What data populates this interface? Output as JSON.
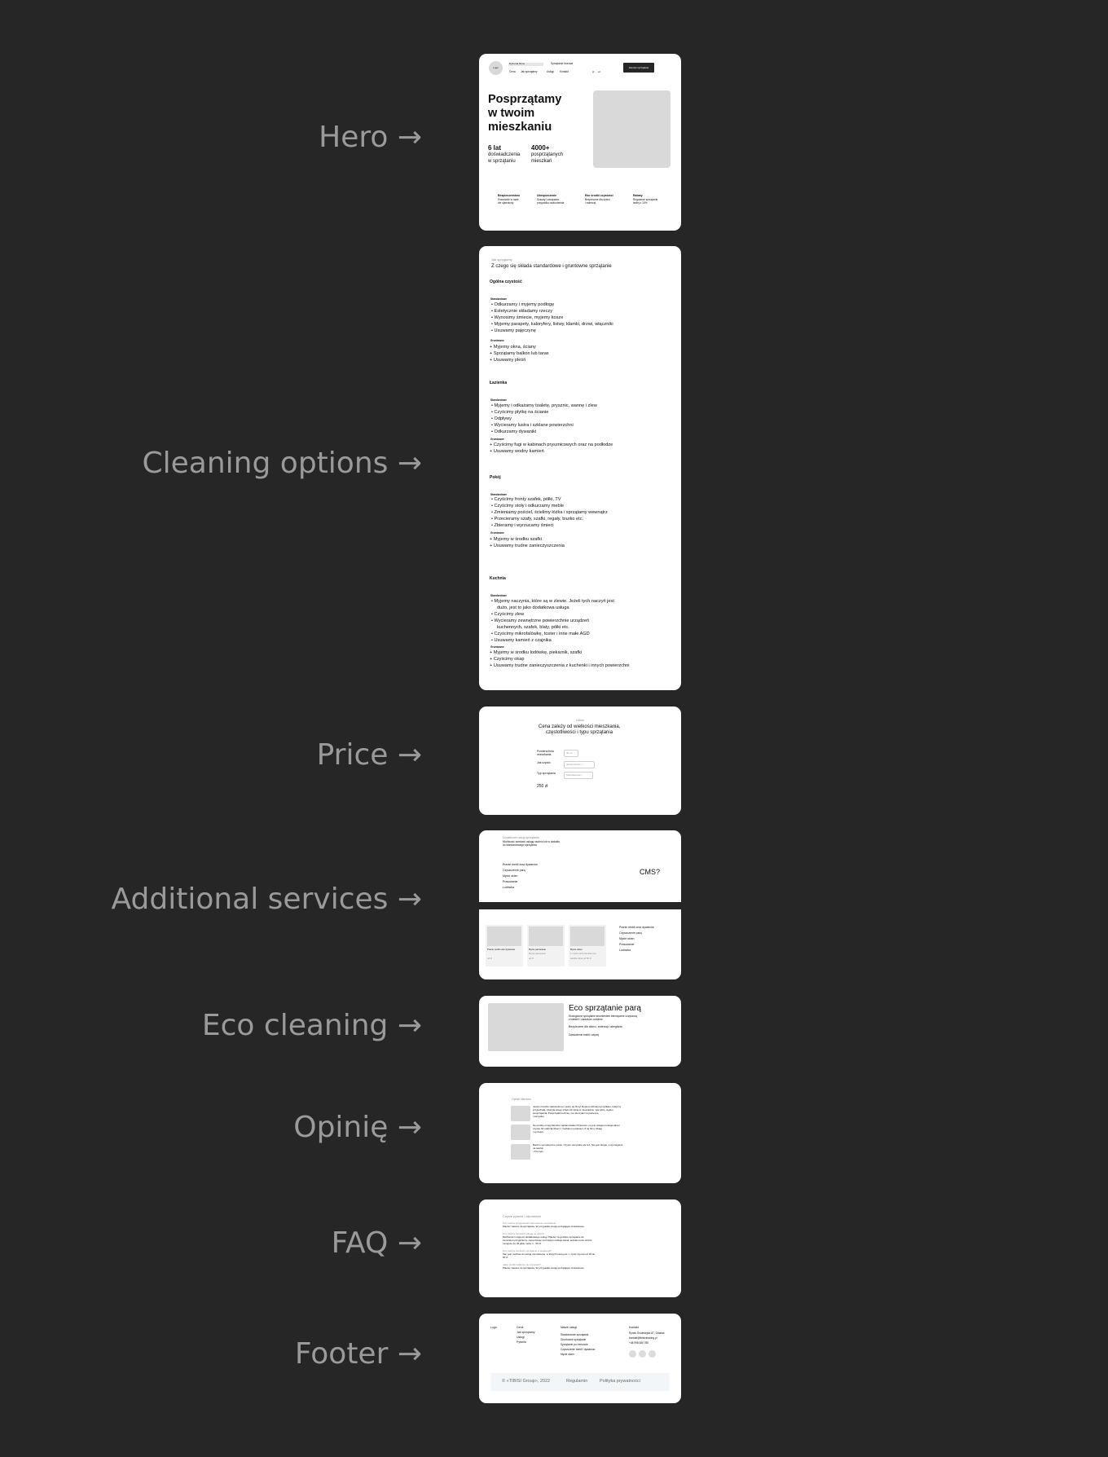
{
  "labels": {
    "hero": "Hero →",
    "cleaning": "Cleaning options  →",
    "price": "Price →",
    "additional": "Additional services →",
    "eco": "Eco cleaning →",
    "opinions": "Opinię →",
    "faq": "FAQ →",
    "footer": "Footer →"
  },
  "hero": {
    "logo": "Logo",
    "nav_top": "Dyżurna firma",
    "nav_top2": "Sprzątanie biurowe",
    "nav": [
      "Cena",
      "Jak sprzątamy",
      "Usługi",
      "Kontakt"
    ],
    "lang": [
      "pl",
      "en"
    ],
    "cta": "Zamów sprzątanie",
    "headline_1": "Posprzątamy",
    "headline_2": "w twoim",
    "headline_3": "mieszkaniu",
    "stat1_value": "6 lat",
    "stat1_text_1": "doświadczenia",
    "stat1_text_2": "w sprzątaniu",
    "stat2_value": "4000+",
    "stat2_text_1": "posprzątanych",
    "stat2_text_2": "mieszkań",
    "features": [
      {
        "title": "Bezpieczeństwo",
        "line1": "Pracownik w razie",
        "line2": "nie ujawniony"
      },
      {
        "title": "Ubezpieczenie",
        "line1": "Szkody i zdrapania",
        "line2": "przypadku uszkodzenia"
      },
      {
        "title": "Eko środki czystości",
        "line1": "Bezpieczne dla dzieci",
        "line2": "i zwierząt"
      },
      {
        "title": "Rabaty",
        "line1": "Regularne sprzątanie",
        "line2": "taniej o 10%"
      }
    ]
  },
  "cleaning": {
    "kicker": "Jak sprzątamy",
    "title": "Z czego się składa standardowe i gruntowne sprzątanie",
    "sections": [
      {
        "name": "Ogólna czystość",
        "std_label": "Standardowe",
        "std": [
          "Odkurzamy i myjemy podłogę",
          "Estetycznie składamy rzeczy",
          "Wynosimy śmiecie, myjemy kosze",
          "Myjemy parapety, kaloryfery, listwy, klamki, drzwi, włączniki",
          "Usuwamy pajęczynę"
        ],
        "gen_label": "Gruntowne",
        "gen": [
          "+ Myjemy okna, ściany",
          "+ Sprzątamy balkon lub taras",
          "+ Usuwamy pleśń"
        ]
      },
      {
        "name": "Łazienka",
        "std_label": "Standardowe",
        "std": [
          "Myjemy i odkażamy toaletę, prysznic, wannę i zlew",
          "Czyścimy płytkę na ścianie",
          "Odpływy",
          "Wycieramy lustra i szklane powierzchni",
          "Odkurzamy dywaniki"
        ],
        "gen_label": "Gruntowne",
        "gen": [
          "+ Czyścimy fugi w kabinach prysznicowych oraz na podłodze",
          "+ Usuwamy wodny kamień"
        ]
      },
      {
        "name": "Pokój",
        "std_label": "Standardowe",
        "std": [
          "Czyścimy fronty szafek, półki, TV",
          "Czyścimy stoły i odkurzamy meble",
          "Zmieniamy pościel, ścielimy łóżka i sprzątamy wewnątrz",
          "Przecieramy szafy, szafki, regały, biurko etc.",
          "Zbieramy i wyrzucamy śmieci"
        ],
        "gen_label": "Gruntowne",
        "gen": [
          "+ Myjemy w środku szafki",
          "+ Usuwamy trudne zanieczyszczenia"
        ]
      },
      {
        "name": "Kuchnia",
        "std_label": "Standardowe",
        "std": [
          "Myjemy naczynia, które są w zlewie. Jeżeli tych naczyń jest",
          "dużo, jest to jako dodatkowa usługa",
          "Czyścimy zlew",
          "Wycieramy zewnętrzne powierzchnie urządzeń",
          "kuchennych, szafek, blaty, półki etc.",
          "Czyścimy mikrofalówkę, toster i inne małe AGD",
          "Usuwamy kamień z czajnika"
        ],
        "gen_label": "Gruntowne",
        "gen": [
          "+ Myjemy w środku lodówkę, piekarnik, szafki",
          "+ Czyścimy okap",
          "+ Usuwamy trudne zanieczyszczenia z kuchenki i innych powierzchni"
        ]
      }
    ]
  },
  "price": {
    "kicker": "Cena",
    "title_1": "Cena zależy od wielkości mieszkania,",
    "title_2": "częstotliwości i typu sprzątania",
    "area_label_1": "Powierzchnia",
    "area_label_2": "mieszkania",
    "area_value": "45 m²",
    "freq_label": "Jak często",
    "freq_value": "Jednorazowo",
    "type_label": "Typ sprzątania",
    "type_value": "Standardowe",
    "total": "250 zł"
  },
  "additional": {
    "kicker": "Dodatkowe usługi sprzątania",
    "sub_1": "Możliwość zamówić usługę osobno lub w dodatku",
    "sub_2": "do standardowego sprzątania",
    "list": [
      "Pranie mebli oraz dywanów",
      "Czyszczenie parą",
      "Mycie okien",
      "Prasowanie",
      "Lodówka"
    ],
    "cms": "CMS?",
    "cards": [
      {
        "title": "Pranie mebli oraz dywanów",
        "price": "od zł"
      },
      {
        "title": "Mycie parowanie",
        "sub": "Mycie parowanie",
        "price": "od zł"
      },
      {
        "title": "Mycie okien",
        "sub": "1 mycie okna dwustronne",
        "price": "wielkie okna od 50 zł"
      }
    ],
    "list2": [
      "Pranie mebli oraz dywanów",
      "Czyszczenie parą",
      "Mycie okien",
      "Prasowanie",
      "Lodówka"
    ]
  },
  "eco": {
    "title": "Eco sprzątanie parą",
    "sub_1": "Ekologiczne sprzątanie strumieniem intensywnie oczyszczą",
    "sub_2": "z bakterii i zarazków ozdobne",
    "text": "Bezpieczne dla dzieci, zwierząt i alergików",
    "link": "Zamówienie mebli i więcej"
  },
  "opinions": {
    "kicker": "Opinie klientów",
    "items": [
      {
        "l1": "Jestem bardzo zadowolona z pracy tej firmy! Dopiero dzisiaj wymyśliłam, która by",
        "l2": "przyjechała, zdobyła wstęp dzięki ich lubią w mieszkaniu, tyle tylko, ciężko",
        "l3": "posprzątania. Posprzątali kuchnię, nie wierzyłam tej łazience,",
        "l4": "i wszystko"
      },
      {
        "l1": "Na prośbę mniej klientów zaplanowałam Pracowni, co jest usługa profesjonalna i",
        "l2": "czysta. Mi odebrał dzieci z i każdemu polecam. Z tej firmy dbają",
        "l3": "i uprzejmi"
      },
      {
        "l1": "Bardzo sympatyczne panie. Czysto wszystkie ale też. Nie jest drogie, a wymaganie",
        "l2": "na telefon",
        "l3": "~Thomas"
      }
    ]
  },
  "faq": {
    "kicker": "Częste pytania i odpowiedzi",
    "items": [
      {
        "q": "Czy można przygotować zamówienie mieszkania",
        "a": "Płacisz zawsze za sprzątanie, W przypadku swoją sprzątające miniaturowe"
      },
      {
        "q": "Czy można zamówić usługę na dzień?",
        "a": "Możliwości mogą do dodatkowego usługi. Płacisz za godzinę sprzątanie do",
        "a2": "zamówień przyjdziemy. Cena biorąc pod wpływ rodzaju kanał, jednak może wrócić",
        "a3": "mniejsze do 45 jakie może 1 - 50 zł"
      },
      {
        "q": "Czy można zamówić sprzątanie w weekend?",
        "a": "Tak, jest możliwe do swoją zamówienia, w których cena jest i + 9 też wynosi od 18 do",
        "a2": "50 zł"
      },
      {
        "q": "Jakie środki zabierze do czystości?",
        "a": "Płacisz zawsze za sprzątanie, W przypadku swoją sprzątające miniaturowe"
      }
    ]
  },
  "footer": {
    "logo": "Logo",
    "col1": [
      "Cena",
      "Jak sprzątamy",
      "Usługi",
      "Pytania"
    ],
    "col2_title": "Nasze usługi",
    "col2": [
      "Standardowe sprzątanie",
      "Gruntowne sprzątanie",
      "Sprzątanie po remoncie",
      "Czyszczenie mebli i dywanów",
      "Mycie okien"
    ],
    "col3_title": "Kontakt",
    "col3": [
      "Rynek Śródmiejski 87, Gdańsk",
      "kontakt@tbisicleaning.pl",
      "+48 998 080 780"
    ],
    "copyright": "© «TIBISI Group», 2022",
    "terms": "Regulamin",
    "privacy": "Polityka prywatności"
  }
}
